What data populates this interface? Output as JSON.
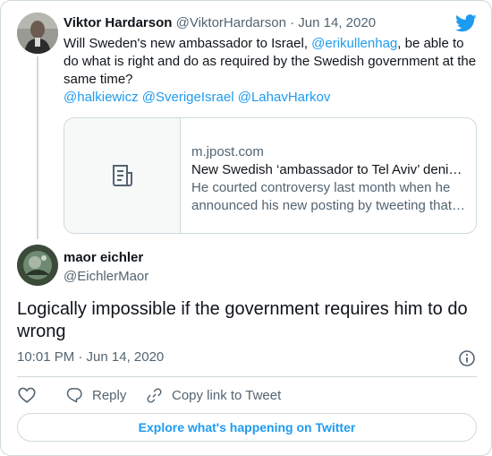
{
  "brand": {
    "accent": "#1d9bf0",
    "text": "#0f1419",
    "muted": "#536471",
    "border": "#cfd9de"
  },
  "quoted_tweet": {
    "author_name": "Viktor Hardarson",
    "author_handle": "@ViktorHardarson",
    "separator": "·",
    "date": "Jun 14, 2020",
    "text_before": "Will Sweden's new ambassador to Israel, ",
    "mention_inline": "@erikullenhag",
    "text_after": ", be able to do what is right and do as required by the Swedish government at the same time?",
    "mentions": [
      "@halkiewicz",
      "@SverigeIsrael",
      "@LahavHarkov"
    ],
    "link_card": {
      "domain": "m.jpost.com",
      "title": "New Swedish ‘ambassador to Tel Aviv’ denies Jerusalem is capital",
      "description": "He courted controversy last month when he announced his new posting by tweeting that he would be ambassador to Tel Aviv",
      "thumb_icon": "article-icon"
    }
  },
  "main_tweet": {
    "author_name": "maor eichler",
    "author_handle": "@EichlerMaor",
    "text": "Logically impossible if the government requires him to do wrong",
    "timestamp": "10:01 PM · Jun 14, 2020"
  },
  "actions": {
    "like_icon": "heart-icon",
    "reply_label": "Reply",
    "copy_label": "Copy link to Tweet"
  },
  "explore_label": "Explore what's happening on Twitter"
}
